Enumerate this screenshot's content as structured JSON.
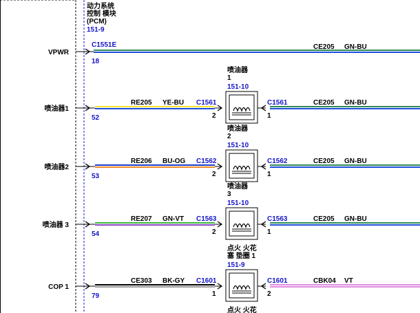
{
  "module": {
    "title_lines": [
      "动力系统",
      "控制 模块",
      "(PCM)"
    ],
    "ref": "151-9"
  },
  "colors": {
    "ref_blue": "#1414c8",
    "GN-BU": [
      "#2e8b57",
      "#1e50dc"
    ],
    "YE-BU": [
      "#f5e52a",
      "#1e50dc"
    ],
    "BU-OG": [
      "#1e3cc8",
      "#f08c28"
    ],
    "GN-VT": [
      "#3cb43c",
      "#8c46c8"
    ],
    "BK-GY": [
      "#000000",
      "#9a9a9a"
    ],
    "VT": [
      "#e08ce0",
      "#e08ce0"
    ]
  },
  "signals": [
    {
      "name": "VPWR",
      "pin": "18",
      "connector": "C1551E",
      "wire_right": {
        "circuit": "CE205",
        "color": "GN-BU"
      }
    },
    {
      "name": "喷油器1",
      "pin": "52",
      "wire_left": {
        "circuit": "RE205",
        "color": "YE-BU",
        "connector": "C1561",
        "pin": "2"
      },
      "component": {
        "lines": [
          "喷油器",
          "1"
        ],
        "ref": "151-10"
      },
      "wire_right": {
        "circuit": "CE205",
        "color": "GN-BU",
        "connector": "C1561",
        "pin": "1"
      }
    },
    {
      "name": "喷油器2",
      "pin": "53",
      "wire_left": {
        "circuit": "RE206",
        "color": "BU-OG",
        "connector": "C1562",
        "pin": "2"
      },
      "component": {
        "lines": [
          "喷油器",
          "2"
        ],
        "ref": "151-10"
      },
      "wire_right": {
        "circuit": "CE205",
        "color": "GN-BU",
        "connector": "C1562",
        "pin": "1"
      }
    },
    {
      "name": "喷油器 3",
      "pin": "54",
      "wire_left": {
        "circuit": "RE207",
        "color": "GN-VT",
        "connector": "C1563",
        "pin": "2"
      },
      "component": {
        "lines": [
          "喷油器",
          "3"
        ],
        "ref": "151-10"
      },
      "wire_right": {
        "circuit": "CE205",
        "color": "GN-BU",
        "connector": "C1563",
        "pin": "1"
      }
    },
    {
      "name": "COP 1",
      "pin": "79",
      "wire_left": {
        "circuit": "CE303",
        "color": "BK-GY",
        "connector": "C1601",
        "pin": "1"
      },
      "component": {
        "lines": [
          "点火 火花",
          "塞 垫圈 1"
        ],
        "ref": "151-9"
      },
      "wire_right": {
        "circuit": "CBK04",
        "color": "VT",
        "connector": "C1601",
        "pin": "2"
      }
    }
  ],
  "partial_component_text": "点火 火花"
}
